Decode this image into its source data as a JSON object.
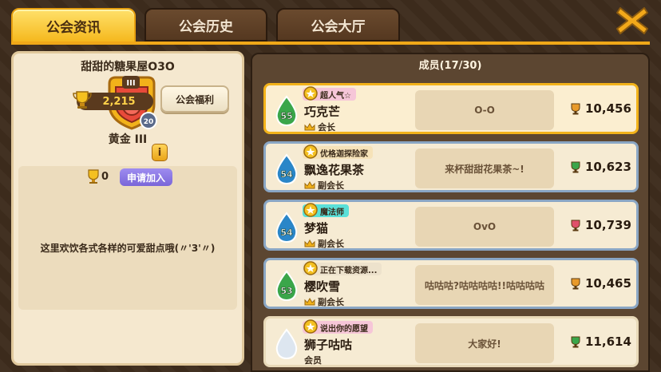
{
  "tabs": [
    {
      "label": "公会资讯",
      "active": true
    },
    {
      "label": "公会历史",
      "active": false
    },
    {
      "label": "公会大厅",
      "active": false
    }
  ],
  "guild": {
    "name": "甜甜的糖果屋O3O",
    "badge_rank": "III",
    "badge_level": "20",
    "welfare_label": "公会福利",
    "rank_name": "黄金 III",
    "points": "2,215",
    "info": "i",
    "required_trophies": "0",
    "apply_label": "申请加入",
    "description": "这里欢饮各式各样的可爱甜点哦(〃'3'〃)"
  },
  "members_header": "成员(17/30)",
  "members": [
    {
      "level": "55",
      "title": "超人气☆",
      "name": "巧克芒",
      "role": "会长",
      "message": "O-O",
      "score": "10,456",
      "drop_color": "#3aa64a",
      "tag_color": "#f6c6d8",
      "trophy_color": "#e89a2a"
    },
    {
      "level": "54",
      "title": "优格迦探险家",
      "name": "飘逸花果茶",
      "role": "副会长",
      "message": "来杯甜甜花果茶~!",
      "score": "10,623",
      "drop_color": "#2a86c8",
      "tag_color": "#f6e2b8",
      "trophy_color": "#3aa64a"
    },
    {
      "level": "54",
      "title": "魔法师",
      "name": "梦猫",
      "role": "副会长",
      "message": "OvO",
      "score": "10,739",
      "drop_color": "#2a86c8",
      "tag_color": "#5ae0d8",
      "trophy_color": "#e0506a"
    },
    {
      "level": "53",
      "title": "正在下载资源...",
      "name": "樱吹雪",
      "role": "副会长",
      "message": "咕咕咕?咕咕咕咕!!咕咕咕咕",
      "score": "10,465",
      "drop_color": "#3aa64a",
      "tag_color": "#ede2cc",
      "trophy_color": "#e89a2a"
    },
    {
      "level": "",
      "title": "说出你的愿望",
      "name": "狮子咕咕",
      "role": "会员",
      "message": "大家好!",
      "score": "11,614",
      "drop_color": "#dde6f0",
      "tag_color": "#f6c6d8",
      "trophy_color": "#3aa64a"
    }
  ]
}
